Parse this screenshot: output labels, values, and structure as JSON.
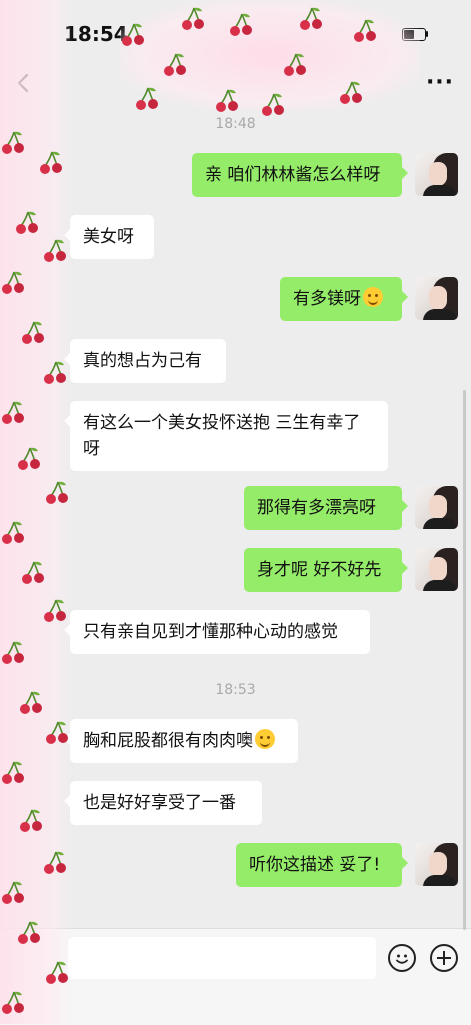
{
  "status_bar": {
    "time": "18:54"
  },
  "nav": {
    "back_glyph": "‹",
    "more_glyph": "···"
  },
  "chat": {
    "timestamps": [
      "18:48",
      "18:53"
    ],
    "messages": [
      {
        "side": "out",
        "text": "亲 咱们林林酱怎么样呀"
      },
      {
        "side": "in",
        "text": "美女呀"
      },
      {
        "side": "out",
        "text": "有多镁呀",
        "emoji": "smiling-face-emoji"
      },
      {
        "side": "in",
        "text": "真的想占为己有"
      },
      {
        "side": "in",
        "text": "有这么一个美女投怀送抱 三生有幸了呀"
      },
      {
        "side": "out",
        "text": "那得有多漂亮呀"
      },
      {
        "side": "out",
        "text": "身才呢 好不好先"
      },
      {
        "side": "in",
        "text": "只有亲自见到才懂那种心动的感觉"
      },
      {
        "side": "in",
        "text": "胸和屁股都很有肉肉噢",
        "emoji": "grinning-face-emoji"
      },
      {
        "side": "in",
        "text": "也是好好享受了一番"
      },
      {
        "side": "out",
        "text": "听你这描述 妥了!"
      }
    ]
  },
  "colors": {
    "outgoing_bubble": "#95ec69",
    "incoming_bubble": "#ffffff",
    "background": "#ededed"
  },
  "icons": {
    "back": "chevron-left-icon",
    "more": "more-icon",
    "emoji": "emoji-icon",
    "plus": "plus-icon",
    "cherry": "cherry-icon"
  }
}
